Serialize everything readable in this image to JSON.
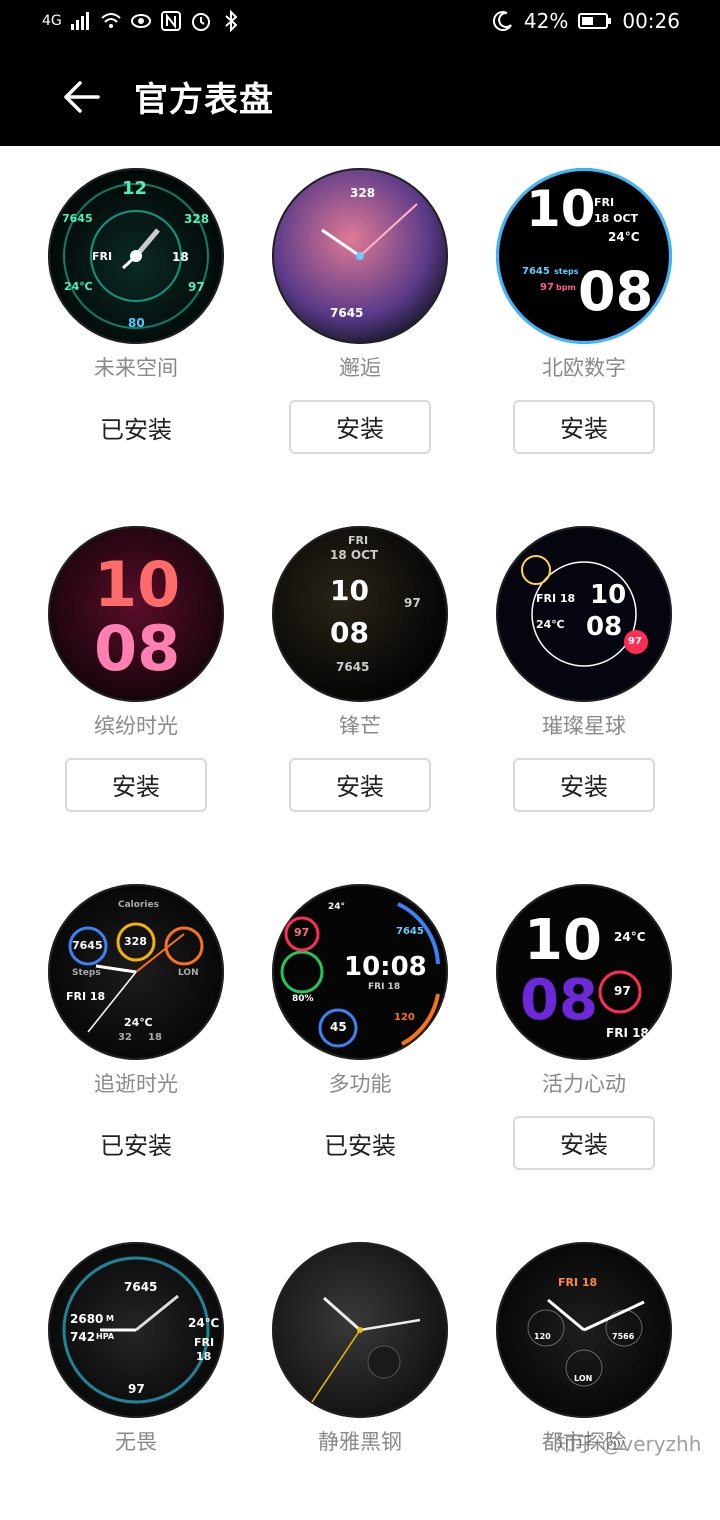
{
  "status": {
    "network": "4G",
    "battery": "42%",
    "time": "00:26"
  },
  "header": {
    "title": "官方表盘"
  },
  "faces": [
    {
      "name": "未来空间",
      "state": "已安装",
      "type": "installed",
      "face_text": {
        "a": "12",
        "b": "FRI",
        "c": "328",
        "d": "18",
        "e": "97",
        "f": "80",
        "g": "7645",
        "h": "24℃"
      }
    },
    {
      "name": "邂逅",
      "state": "安装",
      "type": "button",
      "face_text": {
        "a": "328",
        "b": "7645"
      }
    },
    {
      "name": "北欧数字",
      "state": "安装",
      "type": "button",
      "face_text": {
        "a": "10",
        "b": "FRI",
        "c": "18 OCT",
        "d": "24°C",
        "e": "7645",
        "f": "steps",
        "g": "97",
        "h": "bpm",
        "i": "08"
      }
    },
    {
      "name": "缤纷时光",
      "state": "安装",
      "type": "button",
      "face_text": {
        "a": "10",
        "b": "08"
      }
    },
    {
      "name": "锋芒",
      "state": "安装",
      "type": "button",
      "face_text": {
        "a": "FRI",
        "b": "18 OCT",
        "c": "10",
        "d": "08",
        "e": "97",
        "f": "7645"
      }
    },
    {
      "name": "璀璨星球",
      "state": "安装",
      "type": "button",
      "face_text": {
        "a": "FRI 18",
        "b": "10",
        "c": "24℃",
        "d": "08",
        "e": "97"
      }
    },
    {
      "name": "追逝时光",
      "state": "已安装",
      "type": "installed",
      "face_text": {
        "a": "Calories",
        "b": "7645",
        "c": "328",
        "d": "Steps",
        "e": "LON",
        "f": "FRI 18",
        "g": "24℃",
        "h": "32",
        "i": "18"
      }
    },
    {
      "name": "多功能",
      "state": "已安装",
      "type": "installed",
      "face_text": {
        "a": "24°",
        "b": "7645",
        "c": "97",
        "d": "10:08",
        "e": "FRI 18",
        "f": "80%",
        "g": "45",
        "h": "120"
      }
    },
    {
      "name": "活力心动",
      "state": "安装",
      "type": "button",
      "face_text": {
        "a": "10",
        "b": "24°C",
        "c": "08",
        "d": "97",
        "e": "FRI 18"
      }
    },
    {
      "name": "无畏",
      "state": "",
      "type": "none",
      "face_text": {
        "a": "7645",
        "b": "2680",
        "c": "M",
        "d": "742",
        "e": "HPA",
        "f": "24℃",
        "g": "FRI",
        "h": "18",
        "i": "97"
      }
    },
    {
      "name": "静雅黑钢",
      "state": "",
      "type": "none",
      "face_text": {}
    },
    {
      "name": "都市探险",
      "state": "",
      "type": "none",
      "face_text": {
        "a": "FRI 18",
        "b": "120",
        "c": "7566",
        "d": "LON"
      }
    }
  ],
  "watermark": "知乎 @veryzhh"
}
